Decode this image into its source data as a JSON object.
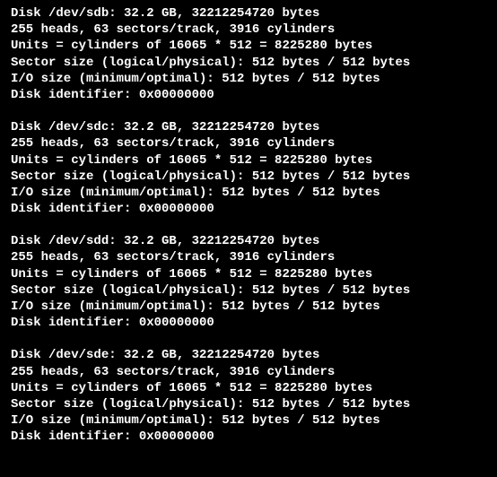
{
  "disks": [
    {
      "header": "Disk /dev/sdb: 32.2 GB, 32212254720 bytes",
      "geometry": "255 heads, 63 sectors/track, 3916 cylinders",
      "units": "Units = cylinders of 16065 * 512 = 8225280 bytes",
      "sector_size": "Sector size (logical/physical): 512 bytes / 512 bytes",
      "io_size": "I/O size (minimum/optimal): 512 bytes / 512 bytes",
      "identifier": "Disk identifier: 0x00000000"
    },
    {
      "header": "Disk /dev/sdc: 32.2 GB, 32212254720 bytes",
      "geometry": "255 heads, 63 sectors/track, 3916 cylinders",
      "units": "Units = cylinders of 16065 * 512 = 8225280 bytes",
      "sector_size": "Sector size (logical/physical): 512 bytes / 512 bytes",
      "io_size": "I/O size (minimum/optimal): 512 bytes / 512 bytes",
      "identifier": "Disk identifier: 0x00000000"
    },
    {
      "header": "Disk /dev/sdd: 32.2 GB, 32212254720 bytes",
      "geometry": "255 heads, 63 sectors/track, 3916 cylinders",
      "units": "Units = cylinders of 16065 * 512 = 8225280 bytes",
      "sector_size": "Sector size (logical/physical): 512 bytes / 512 bytes",
      "io_size": "I/O size (minimum/optimal): 512 bytes / 512 bytes",
      "identifier": "Disk identifier: 0x00000000"
    },
    {
      "header": "Disk /dev/sde: 32.2 GB, 32212254720 bytes",
      "geometry": "255 heads, 63 sectors/track, 3916 cylinders",
      "units": "Units = cylinders of 16065 * 512 = 8225280 bytes",
      "sector_size": "Sector size (logical/physical): 512 bytes / 512 bytes",
      "io_size": "I/O size (minimum/optimal): 512 bytes / 512 bytes",
      "identifier": "Disk identifier: 0x00000000"
    }
  ]
}
